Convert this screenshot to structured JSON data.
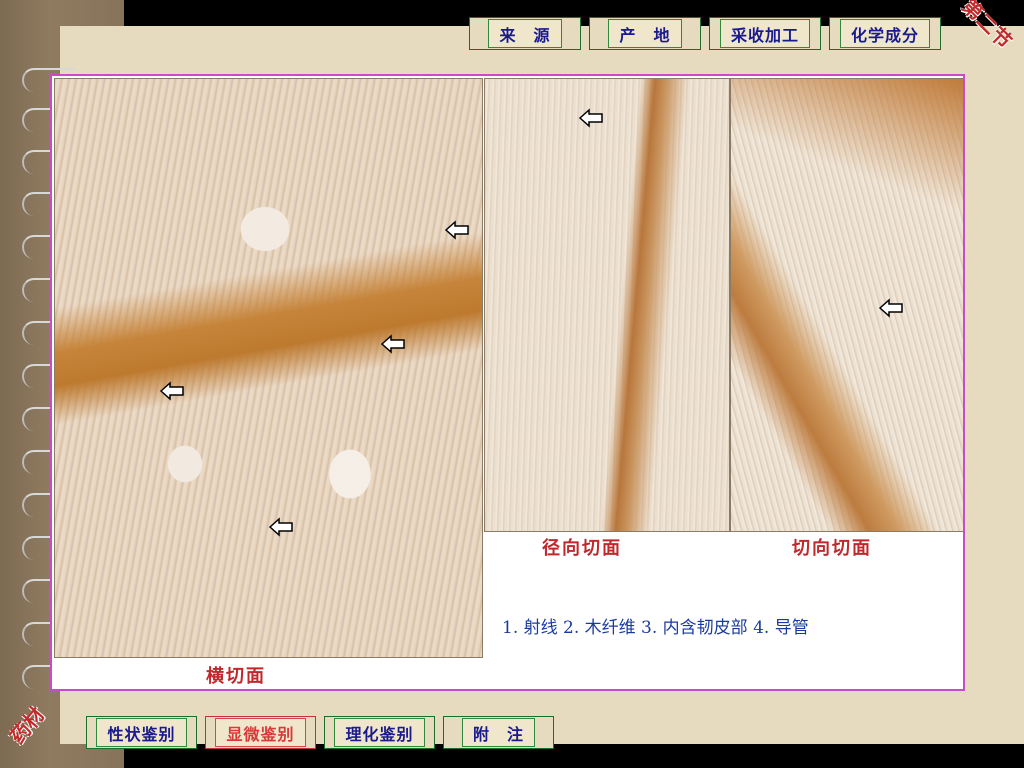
{
  "stamps": {
    "top": "第二节",
    "bottom": "药材"
  },
  "nav_top": [
    {
      "label": "来　源",
      "active": false
    },
    {
      "label": "产　地",
      "active": false
    },
    {
      "label": "采收加工",
      "active": false
    },
    {
      "label": "化学成分",
      "active": false
    }
  ],
  "nav_bottom": [
    {
      "label": "性状鉴别",
      "active": false
    },
    {
      "label": "显微鉴别",
      "active": true
    },
    {
      "label": "理化鉴别",
      "active": false
    },
    {
      "label": "附　注",
      "active": false
    }
  ],
  "figure": {
    "captions": {
      "cross": "横切面",
      "radial": "径向切面",
      "tangential": "切向切面"
    },
    "legend": "1. 射线  2. 木纤维  3. 内含韧皮部  4. 导管",
    "markers": {
      "m1": "1",
      "m2": "2",
      "m3": "3",
      "m4": "4",
      "m5": "1",
      "m6": ""
    }
  },
  "colors": {
    "nav_text": "#1a1a8f",
    "active": "#d83a3a",
    "frame": "#c94bc9",
    "caption": "#c0282c",
    "legend": "#1a3aa0"
  }
}
